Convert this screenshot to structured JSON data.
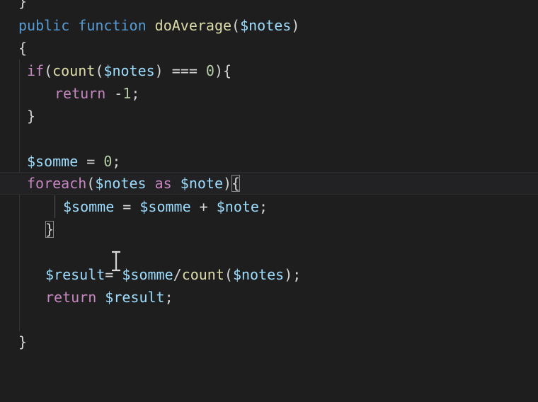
{
  "editor": {
    "lines": {
      "l0": {
        "t1": "}"
      },
      "l1": {
        "t1": "public",
        "t2": " ",
        "t3": "function",
        "t4": " ",
        "t5": "doAverage",
        "t6": "(",
        "t7": "$notes",
        "t8": ")"
      },
      "l2": {
        "t1": "{"
      },
      "l3": {
        "t1": "if",
        "t2": "(",
        "t3": "count",
        "t4": "(",
        "t5": "$notes",
        "t6": ") === ",
        "t7": "0",
        "t8": "){"
      },
      "l4": {
        "t1": "return",
        "t2": " -",
        "t3": "1",
        "t4": ";"
      },
      "l5": {
        "t1": "}"
      },
      "l6": {
        "t1": "$somme",
        "t2": " = ",
        "t3": "0",
        "t4": ";"
      },
      "l7": {
        "t1": "foreach",
        "t2": "(",
        "t3": "$notes",
        "t4": " ",
        "t5": "as",
        "t6": " ",
        "t7": "$note",
        "t8": ")",
        "t9": "{"
      },
      "l8": {
        "t1": "$somme",
        "t2": " = ",
        "t3": "$somme",
        "t4": " + ",
        "t5": "$note",
        "t6": ";"
      },
      "l9": {
        "t1": "}"
      },
      "l10": {
        "t1": "$result",
        "t2": "= ",
        "t3": "$somme",
        "t4": "/",
        "t5": "count",
        "t6": "(",
        "t7": "$notes",
        "t8": ");"
      },
      "l11": {
        "t1": "return",
        "t2": " ",
        "t3": "$result",
        "t4": ";"
      },
      "l12": {
        "t1": "}"
      }
    },
    "colors": {
      "background": "#1e1e1e",
      "keyword": "#c586c0",
      "storage": "#569cd6",
      "function": "#dcdcaa",
      "variable": "#9cdcfe",
      "number": "#b5cea8",
      "punctuation": "#d4d4d4"
    },
    "cursor_icon": "text-cursor-icon"
  }
}
